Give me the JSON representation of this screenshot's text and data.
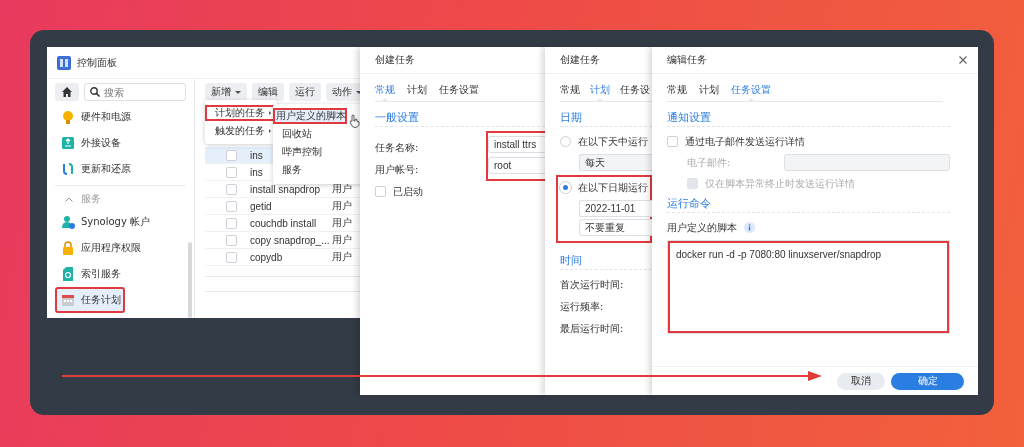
{
  "control_panel": {
    "title": "控制面板",
    "search": {
      "placeholder": "搜索"
    },
    "sidebar": [
      {
        "kind": "item",
        "label": "硬件和电源",
        "selected": false,
        "highlighted": false
      },
      {
        "kind": "item",
        "label": "外接设备",
        "selected": false,
        "highlighted": false
      },
      {
        "kind": "item",
        "label": "更新和还原",
        "selected": false,
        "highlighted": false
      },
      {
        "kind": "section",
        "label": "服务",
        "expanded": true
      },
      {
        "kind": "item",
        "label": "Synology 帐户",
        "selected": false,
        "highlighted": false
      },
      {
        "kind": "item",
        "label": "应用程序权限",
        "selected": false,
        "highlighted": false
      },
      {
        "kind": "item",
        "label": "索引服务",
        "selected": false,
        "highlighted": false
      },
      {
        "kind": "item",
        "label": "任务计划",
        "selected": true,
        "highlighted": true
      }
    ],
    "toolbar": [
      {
        "label": "新增",
        "dropdown": true
      },
      {
        "label": "编辑",
        "dropdown": false
      },
      {
        "label": "运行",
        "dropdown": false
      },
      {
        "label": "动作",
        "dropdown": true
      }
    ],
    "tasks": [
      {
        "name": "ins",
        "selected": true,
        "checked": false
      },
      {
        "name": "ins",
        "selected": false,
        "checked": false
      },
      {
        "name": "install snapdrop",
        "column_2": "用户",
        "selected": false,
        "checked": false
      },
      {
        "name": "getid",
        "column_2": "用户",
        "selected": false,
        "checked": false
      },
      {
        "name": "couchdb install",
        "column_2": "用户",
        "selected": false,
        "checked": false
      },
      {
        "name": "copy snapdrop_...",
        "column_2": "用户",
        "selected": false,
        "checked": false
      },
      {
        "name": "copydb",
        "column_2": "用户",
        "selected": false,
        "checked": false
      }
    ],
    "menu": [
      {
        "label": "计划的任务",
        "submenu": true,
        "highlighted": true
      },
      {
        "label": "触发的任务",
        "submenu": true,
        "highlighted": false
      }
    ],
    "submenu": [
      {
        "label": "用户定义的脚本",
        "hovered": true,
        "highlighted": true
      },
      {
        "label": "回收站",
        "hovered": false,
        "highlighted": false
      },
      {
        "label": "哔声控制",
        "hovered": false,
        "highlighted": false
      },
      {
        "label": "服务",
        "hovered": false,
        "highlighted": false
      }
    ]
  },
  "dialogs": [
    {
      "title": "创建任务",
      "tabs": [
        {
          "label": "常规",
          "selected": true
        },
        {
          "label": "计划",
          "selected": false
        },
        {
          "label": "任务设置",
          "selected": false
        }
      ],
      "content": [
        {
          "kind": "section",
          "label": "一般设置"
        },
        {
          "kind": "form",
          "highlighted": true,
          "fields": [
            {
              "label": "任务名称:",
              "value": "install ttrs"
            },
            {
              "label": "用户帐号:",
              "value": "root"
            }
          ]
        },
        {
          "kind": "checkbox",
          "label": "已启动",
          "checked": false,
          "disabled": false
        }
      ]
    },
    {
      "title": "创建任务",
      "tabs": [
        {
          "label": "常规",
          "selected": false
        },
        {
          "label": "计划",
          "selected": true
        },
        {
          "label": "任务设",
          "selected": false
        }
      ],
      "content": [
        {
          "kind": "section",
          "label": "日期"
        },
        {
          "kind": "radio",
          "label": "在以下天中运行",
          "selected": false
        },
        {
          "kind": "input",
          "value": "每天",
          "disabled": true
        },
        {
          "kind": "group",
          "highlighted": true,
          "children": [
            {
              "kind": "radio",
              "label": "在以下日期运行",
              "selected": true
            },
            {
              "kind": "input",
              "value": "2022-11-01",
              "disabled": false
            },
            {
              "kind": "input",
              "value": "不要重复",
              "disabled": false
            }
          ]
        },
        {
          "kind": "section",
          "label": "时间"
        },
        {
          "kind": "label",
          "label": "首次运行时间:"
        },
        {
          "kind": "label",
          "label": "运行频率:"
        },
        {
          "kind": "label",
          "label": "最后运行时间:"
        }
      ]
    },
    {
      "title": "编辑任务",
      "close": true,
      "tabs": [
        {
          "label": "常规",
          "selected": false
        },
        {
          "label": "计划",
          "selected": false
        },
        {
          "label": "任务设置",
          "selected": true
        }
      ],
      "content": [
        {
          "kind": "section",
          "label": "通知设置"
        },
        {
          "kind": "checkbox",
          "label": "通过电子邮件发送运行详情",
          "checked": false,
          "disabled": false
        },
        {
          "kind": "field",
          "label": "电子邮件:",
          "disabled": true
        },
        {
          "kind": "checkbox",
          "label": "仅在脚本异常终止时发送运行详情",
          "checked": false,
          "disabled": true
        },
        {
          "kind": "section",
          "label": "运行命令"
        },
        {
          "kind": "script_label",
          "label": "用户定义的脚本",
          "info": true
        },
        {
          "kind": "textarea",
          "value": "docker run -d -p 7080:80 linuxserver/snapdrop",
          "highlighted": true
        }
      ],
      "buttons": [
        {
          "label": "取消",
          "kind": "secondary"
        },
        {
          "label": "确定",
          "kind": "primary"
        }
      ]
    }
  ],
  "annotation_arrow": true
}
